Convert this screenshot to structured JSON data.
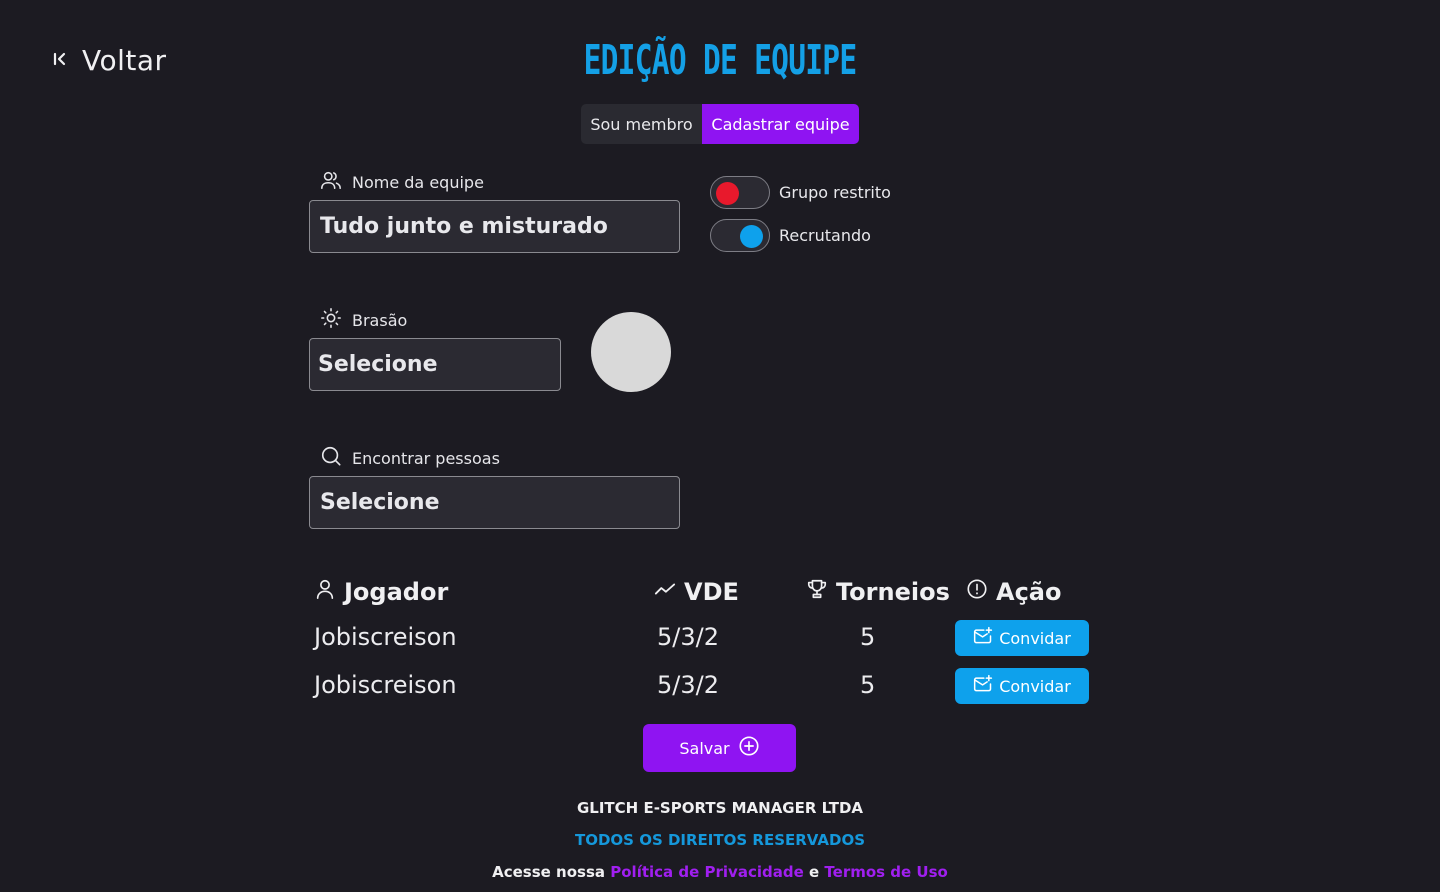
{
  "nav": {
    "back_label": "Voltar"
  },
  "header": {
    "title": "EDIÇÃO DE EQUIPE"
  },
  "tabs": [
    {
      "label": "Sou membro",
      "active": false
    },
    {
      "label": "Cadastrar equipe",
      "active": true
    }
  ],
  "form": {
    "team_name": {
      "label": "Nome da equipe",
      "value": "Tudo junto e misturado"
    },
    "crest": {
      "label": "Brasão",
      "value": "Selecione"
    },
    "find_people": {
      "label": "Encontrar pessoas",
      "value": "Selecione"
    }
  },
  "toggles": [
    {
      "label": "Grupo restrito",
      "on": false,
      "knob_color": "#e8192c"
    },
    {
      "label": "Recrutando",
      "on": true,
      "knob_color": "#0ea1ec"
    }
  ],
  "table": {
    "headers": {
      "player": "Jogador",
      "vde": "VDE",
      "tournaments": "Torneios",
      "action": "Ação"
    },
    "rows": [
      {
        "player": "Jobiscreison",
        "vde": "5/3/2",
        "tournaments": "5",
        "action": "Convidar"
      },
      {
        "player": "Jobiscreison",
        "vde": "5/3/2",
        "tournaments": "5",
        "action": "Convidar"
      }
    ]
  },
  "save_label": "Salvar",
  "footer": {
    "company": "GLITCH E-SPORTS MANAGER LTDA",
    "rights": "TODOS OS DIREITOS RESERVADOS",
    "access_prefix": "Acesse nossa",
    "privacy": "Política de Privacidade",
    "and": "e",
    "terms": "Termos de Uso"
  },
  "colors": {
    "accent_purple": "#8f14f2",
    "accent_blue": "#0ea1ec",
    "background": "#1c1b22"
  }
}
